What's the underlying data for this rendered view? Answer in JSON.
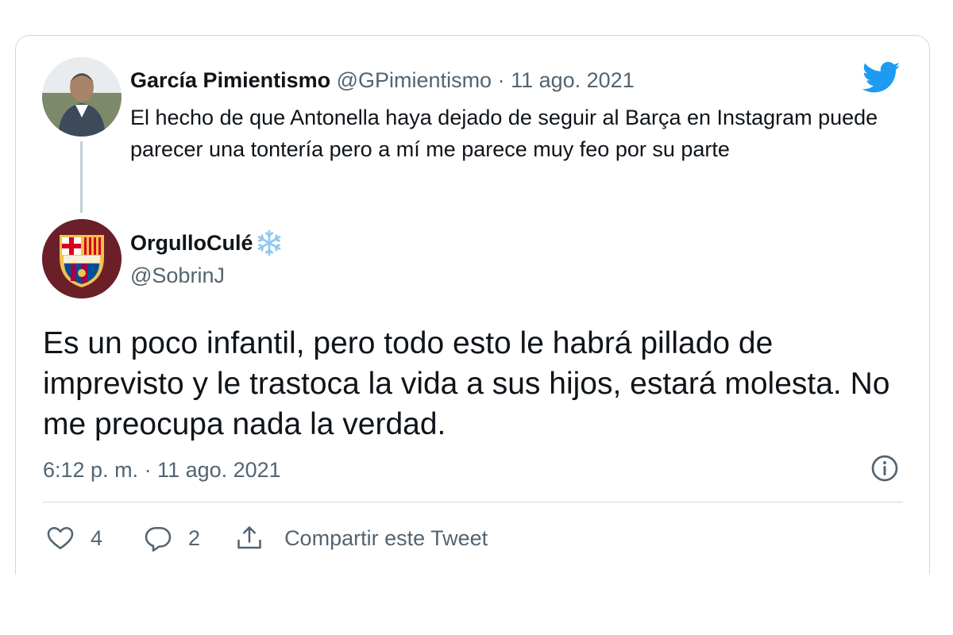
{
  "parent_tweet": {
    "author_name": "García Pimientismo",
    "meta": "@GPimientismo · 11 ago. 2021",
    "text": "El hecho de que Antonella haya dejado de seguir al Barça en Instagram puede parecer una tontería pero a mí me parece muy feo por su parte"
  },
  "tweet": {
    "author_name": "OrgulloCulé",
    "author_handle": "@SobrinJ",
    "text": "Es un poco infantil, pero todo esto le habrá pillado de imprevisto y le trastoca la vida a sus hijos, estará molesta. No me preocupa nada la verdad.",
    "timestamp": "6:12 p. m. · 11 ago. 2021"
  },
  "actions": {
    "like_count": "4",
    "reply_count": "2",
    "share_label": "Compartir este Tweet"
  },
  "icons": {
    "brand": "twitter-bird-icon",
    "name_badge": "snowflake-icon",
    "info": "info-icon",
    "like": "heart-icon",
    "reply": "reply-bubble-icon",
    "share": "share-icon"
  },
  "colors": {
    "twitter_blue": "#1d9bf0",
    "text_primary": "#0f1419",
    "text_secondary": "#536471",
    "border": "#cfd9de",
    "barca_blue": "#004d98",
    "barca_red": "#a50044"
  }
}
